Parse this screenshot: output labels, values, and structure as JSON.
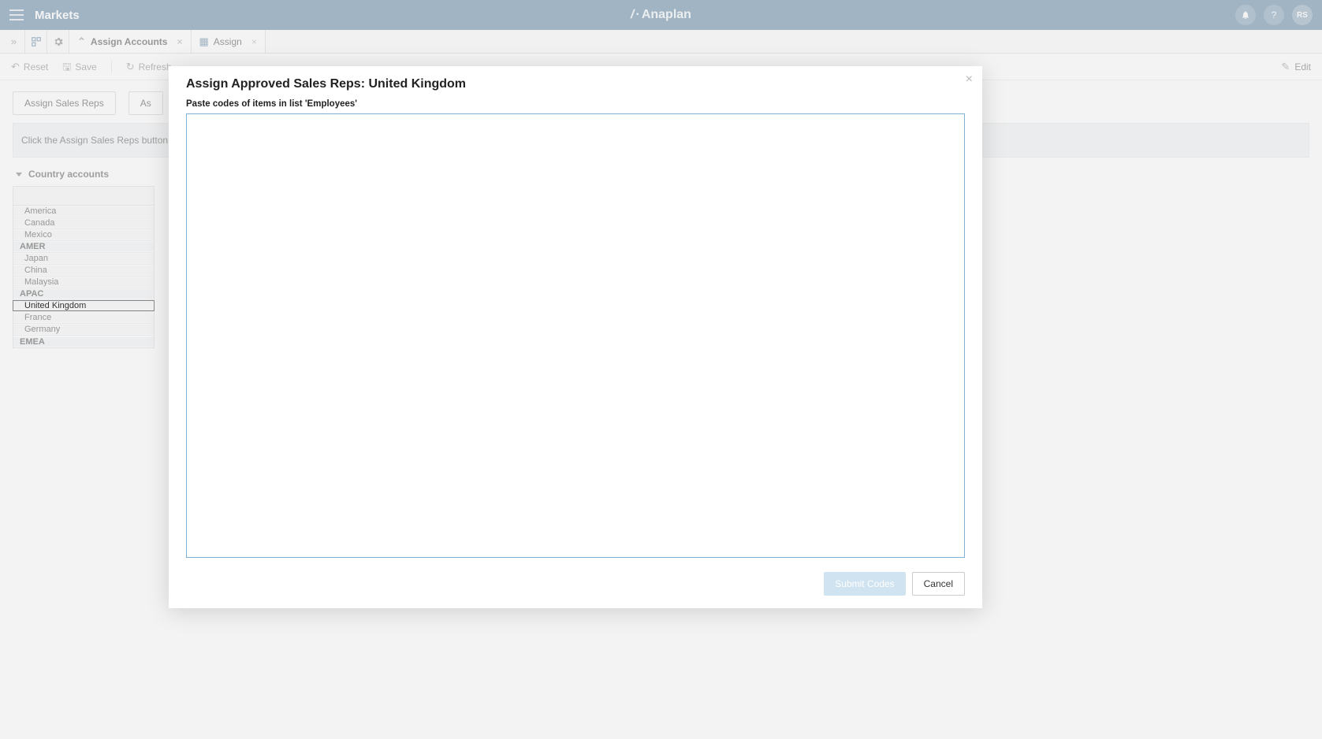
{
  "header": {
    "app_title": "Markets",
    "brand": "Anaplan",
    "avatar_initials": "RS"
  },
  "tabs": [
    {
      "label": "Assign Accounts",
      "active": true,
      "icon": "caret-up"
    },
    {
      "label": "Assign",
      "active": false,
      "icon": "grid"
    }
  ],
  "toolbar": {
    "reset": "Reset",
    "save": "Save",
    "refresh": "Refresh",
    "edit": "Edit"
  },
  "buttons": {
    "assign_sales_reps": "Assign Sales Reps",
    "second_button_partial": "As"
  },
  "info_strip": "Click the Assign Sales Reps button",
  "section": {
    "title": "Country accounts",
    "rows": [
      {
        "label": "America",
        "type": "country"
      },
      {
        "label": "Canada",
        "type": "country"
      },
      {
        "label": "Mexico",
        "type": "country"
      },
      {
        "label": "AMER",
        "type": "region"
      },
      {
        "label": "Japan",
        "type": "country"
      },
      {
        "label": "China",
        "type": "country"
      },
      {
        "label": "Malaysia",
        "type": "country"
      },
      {
        "label": "APAC",
        "type": "region"
      },
      {
        "label": "United Kingdom",
        "type": "country",
        "selected": true
      },
      {
        "label": "France",
        "type": "country"
      },
      {
        "label": "Germany",
        "type": "country"
      },
      {
        "label": "EMEA",
        "type": "region"
      }
    ]
  },
  "modal": {
    "title": "Assign Approved Sales Reps: United Kingdom",
    "subtitle": "Paste codes of items in list 'Employees'",
    "textarea_value": "",
    "submit_label": "Submit Codes",
    "cancel_label": "Cancel"
  }
}
